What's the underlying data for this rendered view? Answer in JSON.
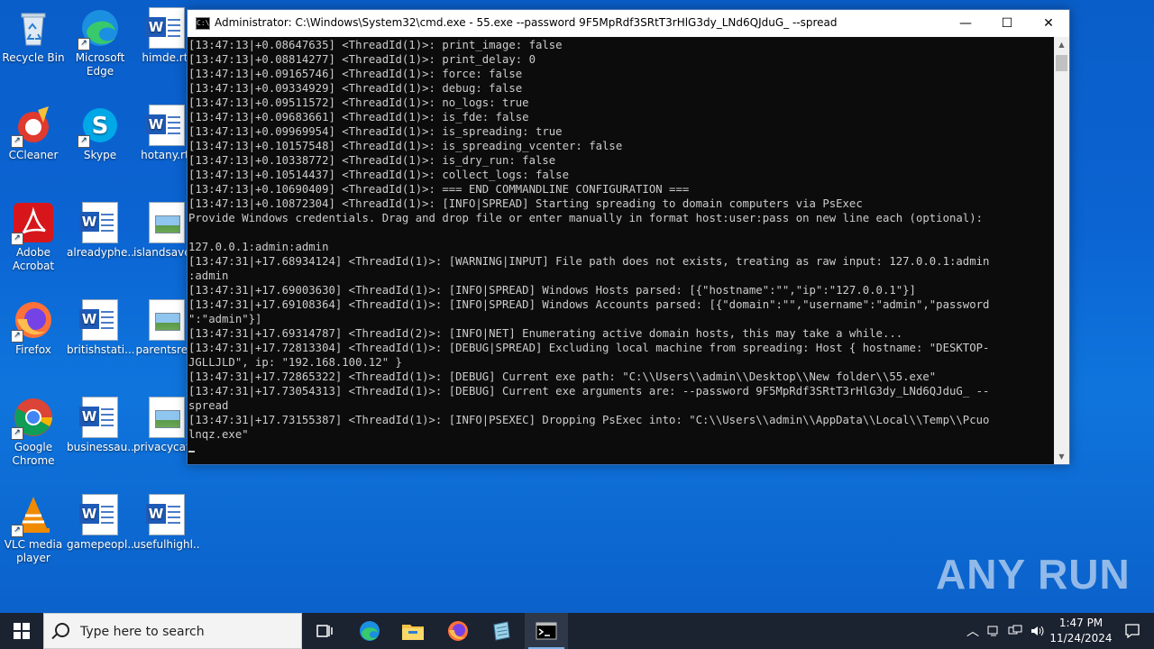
{
  "desktop": {
    "icons": [
      {
        "label": "Recycle Bin",
        "icon": "recycle-bin-icon"
      },
      {
        "label": "Microsoft Edge",
        "label_line2": "Edge",
        "label_line1": "Microsoft",
        "icon": "edge-icon"
      },
      {
        "label": "himde.rtf",
        "icon": "word-document-icon"
      },
      {
        "label": "CCleaner",
        "icon": "ccleaner-icon"
      },
      {
        "label": "Skype",
        "icon": "skype-icon"
      },
      {
        "label": "hotany.rtf",
        "icon": "word-document-icon"
      },
      {
        "label_line1": "Adobe",
        "label_line2": "Acrobat",
        "icon": "adobe-acrobat-icon"
      },
      {
        "label": "alreadyphe...",
        "icon": "word-document-icon"
      },
      {
        "label": "islandsave...",
        "icon": "image-file-icon"
      },
      {
        "label": "Firefox",
        "icon": "firefox-icon"
      },
      {
        "label": "britishstati...",
        "icon": "word-document-icon"
      },
      {
        "label": "parentsre...",
        "icon": "image-file-icon"
      },
      {
        "label_line1": "Google",
        "label_line2": "Chrome",
        "icon": "chrome-icon"
      },
      {
        "label": "businessau...",
        "icon": "word-document-icon"
      },
      {
        "label": "privacycat...",
        "icon": "image-file-icon"
      },
      {
        "label_line1": "VLC media",
        "label_line2": "player",
        "icon": "vlc-icon"
      },
      {
        "label": "gamepeopl...",
        "icon": "word-document-icon"
      },
      {
        "label": "usefulhighl...",
        "icon": "word-document-icon"
      }
    ]
  },
  "window": {
    "title": "Administrator: C:\\Windows\\System32\\cmd.exe - 55.exe  --password 9F5MpRdf3SRtT3rHlG3dy_LNd6QJduG_ --spread",
    "minimize": "—",
    "maximize": "☐",
    "close": "✕",
    "console_text": "[13:47:13|+0.08647635] <ThreadId(1)>: print_image: false\n[13:47:13|+0.08814277] <ThreadId(1)>: print_delay: 0\n[13:47:13|+0.09165746] <ThreadId(1)>: force: false\n[13:47:13|+0.09334929] <ThreadId(1)>: debug: false\n[13:47:13|+0.09511572] <ThreadId(1)>: no_logs: true\n[13:47:13|+0.09683661] <ThreadId(1)>: is_fde: false\n[13:47:13|+0.09969954] <ThreadId(1)>: is_spreading: true\n[13:47:13|+0.10157548] <ThreadId(1)>: is_spreading_vcenter: false\n[13:47:13|+0.10338772] <ThreadId(1)>: is_dry_run: false\n[13:47:13|+0.10514437] <ThreadId(1)>: collect_logs: false\n[13:47:13|+0.10690409] <ThreadId(1)>: === END COMMANDLINE CONFIGURATION ===\n[13:47:13|+0.10872304] <ThreadId(1)>: [INFO|SPREAD] Starting spreading to domain computers via PsExec\nProvide Windows credentials. Drag and drop file or enter manually in format host:user:pass on new line each (optional):\n\n127.0.0.1:admin:admin\n[13:47:31|+17.68934124] <ThreadId(1)>: [WARNING|INPUT] File path does not exists, treating as raw input: 127.0.0.1:admin\n:admin\n[13:47:31|+17.69003630] <ThreadId(1)>: [INFO|SPREAD] Windows Hosts parsed: [{\"hostname\":\"\",\"ip\":\"127.0.0.1\"}]\n[13:47:31|+17.69108364] <ThreadId(1)>: [INFO|SPREAD] Windows Accounts parsed: [{\"domain\":\"\",\"username\":\"admin\",\"password\n\":\"admin\"}]\n[13:47:31|+17.69314787] <ThreadId(2)>: [INFO|NET] Enumerating active domain hosts, this may take a while...\n[13:47:31|+17.72813304] <ThreadId(1)>: [DEBUG|SPREAD] Excluding local machine from spreading: Host { hostname: \"DESKTOP-\nJGLLJLD\", ip: \"192.168.100.12\" }\n[13:47:31|+17.72865322] <ThreadId(1)>: [DEBUG] Current exe path: \"C:\\\\Users\\\\admin\\\\Desktop\\\\New folder\\\\55.exe\"\n[13:47:31|+17.73054313] <ThreadId(1)>: [DEBUG] Current exe arguments are: --password 9F5MpRdf3SRtT3rHlG3dy_LNd6QJduG_ --\nspread\n[13:47:31|+17.73155387] <ThreadId(1)>: [INFO|PSEXEC] Dropping PsExec into: \"C:\\\\Users\\\\admin\\\\AppData\\\\Local\\\\Temp\\\\Pcuo\nlnqz.exe\"\n"
  },
  "watermark": "ANY RUN",
  "taskbar": {
    "search_placeholder": "Type here to search",
    "time": "1:47 PM",
    "date": "11/24/2024",
    "apps": [
      "task-view-icon",
      "edge-icon",
      "file-explorer-icon",
      "firefox-icon",
      "notepad-icon",
      "cmd-icon"
    ]
  },
  "colors": {
    "console_bg": "#0c0c0c",
    "console_fg": "#cccccc",
    "taskbar_bg": "#1b2230",
    "desktop_blue": "#0b64d2"
  }
}
